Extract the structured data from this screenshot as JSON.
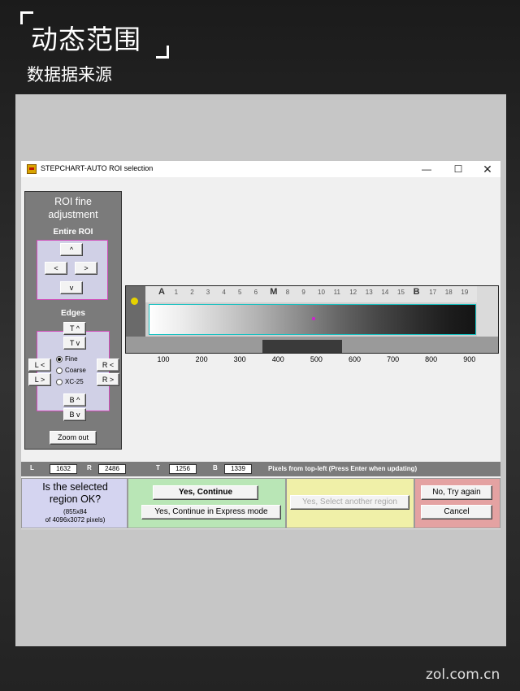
{
  "header": {
    "title": "动态范围",
    "subtitle": "数据据来源"
  },
  "window": {
    "title": "STEPCHART-AUTO ROI selection",
    "controls": {
      "minimize": "—",
      "maximize": "☐",
      "close": "✕"
    }
  },
  "left_panel": {
    "title_line1": "ROI fine",
    "title_line2": "adjustment",
    "entire_roi_label": "Entire ROI",
    "entire_buttons": {
      "up": "^",
      "left": "<",
      "right": ">",
      "down": "v"
    },
    "edges_label": "Edges",
    "edge_buttons": {
      "top_up": "T ^",
      "top_down": "T v",
      "left_left": "L <",
      "left_right": "L >",
      "right_left": "R <",
      "right_right": "R >",
      "bottom_up": "B ^",
      "bottom_down": "B v"
    },
    "step_options": [
      {
        "label": "Fine",
        "selected": true
      },
      {
        "label": "Coarse",
        "selected": false
      },
      {
        "label": "XC-25",
        "selected": false
      }
    ],
    "zoom_out_label": "Zoom out"
  },
  "image": {
    "chart_labels": [
      "A",
      "1",
      "2",
      "3",
      "4",
      "5",
      "6",
      "M",
      "8",
      "9",
      "10",
      "11",
      "12",
      "13",
      "14",
      "15",
      "B",
      "17",
      "18",
      "19"
    ],
    "axis_ticks": [
      "100",
      "200",
      "300",
      "400",
      "500",
      "600",
      "700",
      "800",
      "900"
    ]
  },
  "coords": {
    "l_label": "L",
    "l_value": "1632",
    "r_label": "R",
    "r_value": "2486",
    "t_label": "T",
    "t_value": "1256",
    "b_label": "B",
    "b_value": "1339",
    "note": "Pixels from top-left  (Press Enter when updating)"
  },
  "confirm": {
    "question_line1": "Is the selected",
    "question_line2": "region OK?",
    "size": "(855x84",
    "of_total": "of 4096x3072 pixels)",
    "yes_continue": "Yes, Continue",
    "yes_express": "Yes, Continue in Express mode",
    "select_another": "Yes, Select another region",
    "try_again": "No, Try again",
    "cancel": "Cancel"
  },
  "watermark": "zol.com.cn",
  "colors": {
    "roi_outline": "#15c0c0",
    "panel_purple": "#d4d4f0",
    "panel_green": "#b9e6b6",
    "panel_yellow": "#f0f0a8",
    "panel_red": "#e4a2a2"
  }
}
